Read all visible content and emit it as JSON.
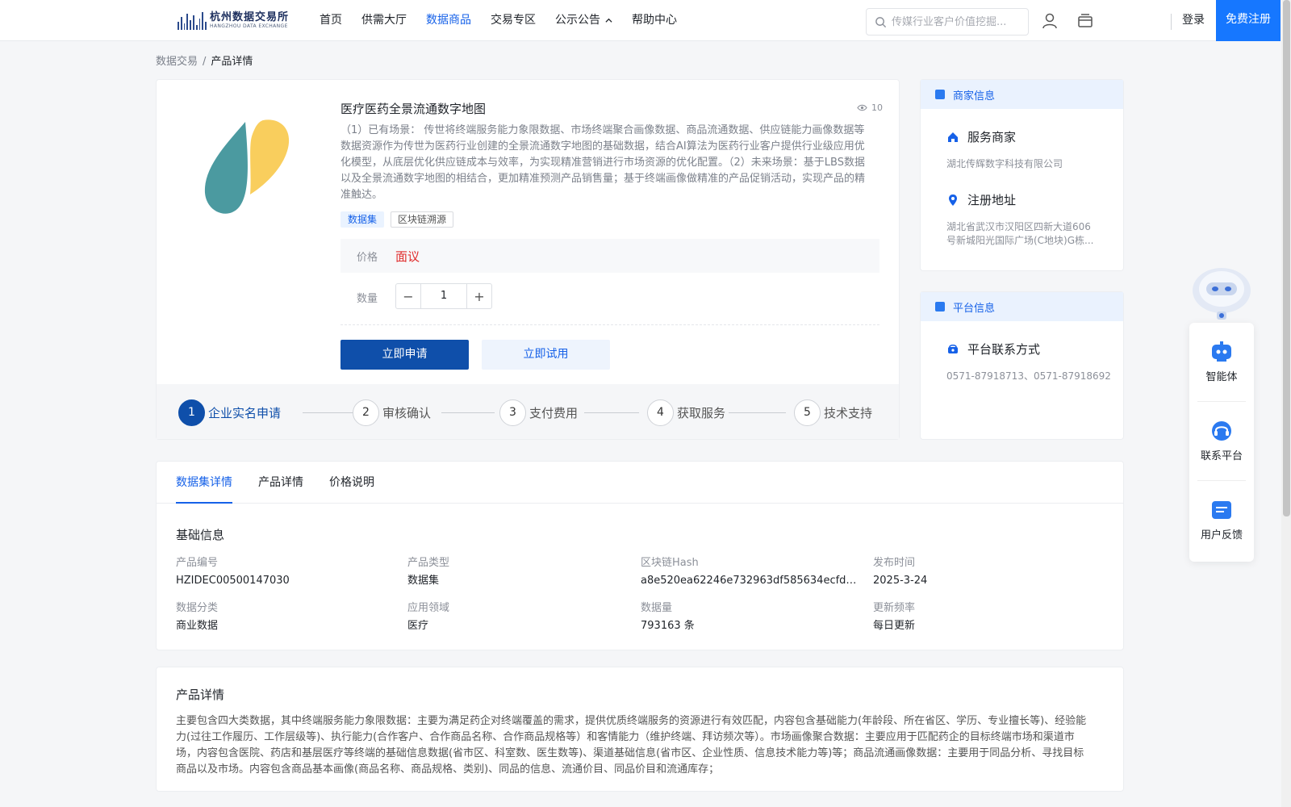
{
  "header": {
    "logo_cn": "杭州数据交易所",
    "logo_en": "HANGZHOU DATA EXCHANGE",
    "nav": [
      {
        "label": "首页",
        "active": false
      },
      {
        "label": "供需大厅",
        "active": false
      },
      {
        "label": "数据商品",
        "active": true
      },
      {
        "label": "交易专区",
        "active": false
      },
      {
        "label": "公示公告",
        "active": false,
        "has_chevron": true
      },
      {
        "label": "帮助中心",
        "active": false
      }
    ],
    "search_placeholder": "传媒行业客户价值挖掘...",
    "login": "登录",
    "register": "免费注册",
    "icons": [
      "search-icon",
      "user-icon",
      "store-icon",
      "chevron-up-icon"
    ]
  },
  "breadcrumb": {
    "parent": "数据交易",
    "separator": "/",
    "current": "产品详情"
  },
  "product": {
    "title": "医疗医药全景流通数字地图",
    "views": "10",
    "description": "（1）已有场景： 传世将终端服务能力象限数据、市场终端聚合画像数据、商品流通数据、供应链能力画像数据等数据资源作为传世为医药行业创建的全景流通数字地图的基础数据，结合AI算法为医药行业客户提供行业级应用优化模型，从底层优化供应链成本与效率，为实现精准营销进行市场资源的优化配置。（2）未来场景：基于LBS数据以及全景流通数字地图的相结合，更加精准预测产品销售量；基于终端画像做精准的产品促销活动，实现产品的精准触达。",
    "tags": [
      "数据集",
      "区块链溯源"
    ],
    "price_label": "价格",
    "price_value": "面议",
    "qty_label": "数量",
    "qty_value": "1",
    "apply_label": "立即申请",
    "trial_label": "立即试用",
    "steps": [
      {
        "num": "1",
        "label": "企业实名申请",
        "active": true
      },
      {
        "num": "2",
        "label": "审核确认",
        "active": false
      },
      {
        "num": "3",
        "label": "支付费用",
        "active": false
      },
      {
        "num": "4",
        "label": "获取服务",
        "active": false
      },
      {
        "num": "5",
        "label": "技术支持",
        "active": false
      }
    ]
  },
  "merchant": {
    "title": "商家信息",
    "service_label": "服务商家",
    "service_value": "湖北传辉数字科技有限公司",
    "address_label": "注册地址",
    "address_value": "湖北省武汉市汉阳区四新大道606号新城阳光国际广场(C地块)G栋..."
  },
  "platform": {
    "title": "平台信息",
    "contact_label": "平台联系方式",
    "contact_value": "0571-87918713、0571-87918692"
  },
  "float_panel": [
    {
      "label": "智能体",
      "icon": "robot-icon"
    },
    {
      "label": "联系平台",
      "icon": "headset-icon"
    },
    {
      "label": "用户反馈",
      "icon": "feedback-icon"
    }
  ],
  "tabs": [
    "数据集详情",
    "产品详情",
    "价格说明"
  ],
  "basic_info": {
    "title": "基础信息",
    "fields": [
      {
        "label": "产品编号",
        "value": "HZIDEC00500147030"
      },
      {
        "label": "产品类型",
        "value": "数据集"
      },
      {
        "label": "区块链Hash",
        "value": "a8e520ea62246e732963df585634ecfd09..."
      },
      {
        "label": "发布时间",
        "value": "2025-3-24"
      },
      {
        "label": "数据分类",
        "value": "商业数据"
      },
      {
        "label": "应用领域",
        "value": "医疗"
      },
      {
        "label": "数据量",
        "value": "793163 条"
      },
      {
        "label": "更新频率",
        "value": "每日更新"
      }
    ]
  },
  "product_detail": {
    "title": "产品详情",
    "text": "主要包含四大类数据，其中终端服务能力象限数据：主要为满足药企对终端覆盖的需求，提供优质终端服务的资源进行有效匹配，内容包含基础能力(年龄段、所在省区、学历、专业擅长等)、经验能力(过往工作履历、工作层级等)、执行能力(合作客户、合作商品名称、合作商品规格等）和客情能力（维护终端、拜访频次等）。市场画像聚合数据：主要应用于匹配药企的目标终端市场和渠道市场，内容包含医院、药店和基层医疗等终端的基础信息数据(省市区、科室数、医生数等)、渠道基础信息(省市区、企业性质、信息技术能力等)等；商品流通画像数据：主要用于同品分析、寻找目标商品以及市场。内容包含商品基本画像(商品名称、商品规格、类别)、同品的信息、流通价目、同品价目和流通库存；"
  },
  "colors": {
    "primary": "#1661e8",
    "dark_blue": "#0f4faa",
    "price_red": "#e02c2c",
    "register_blue": "#1677ff"
  }
}
